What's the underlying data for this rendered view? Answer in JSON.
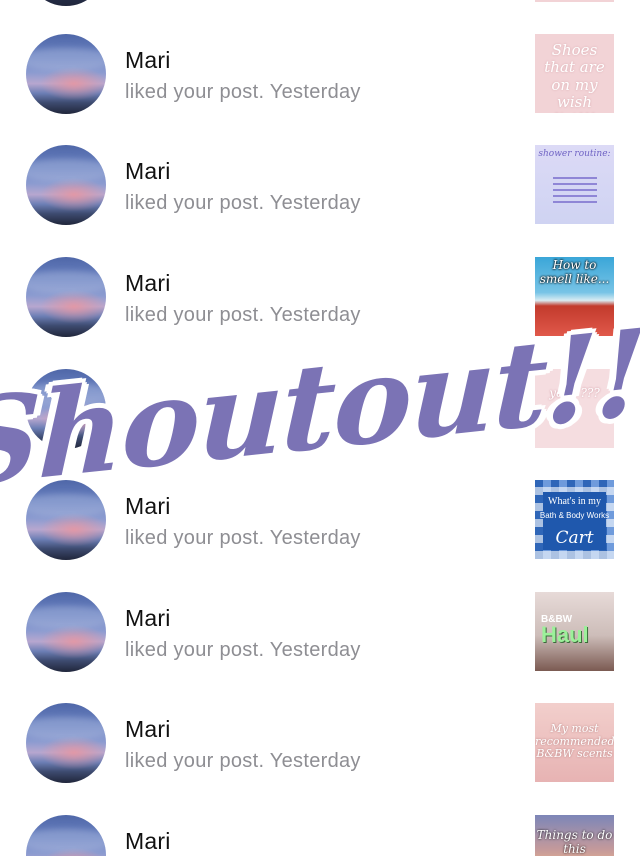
{
  "overlay": {
    "text": "Shoutout!!!",
    "color": "#7b73b5"
  },
  "colors": {
    "name": "#111111",
    "secondary": "#8e8e93",
    "background": "#ffffff"
  },
  "notifications": [
    {
      "name": "Mari",
      "action": "liked your post. Yesterday",
      "thumb_text": "Shoes that are on my wish list!!!"
    },
    {
      "name": "Mari",
      "action": "liked your post. Yesterday",
      "thumb_text": "shower routine:"
    },
    {
      "name": "Mari",
      "action": "liked your post. Yesterday",
      "thumb_text": "How to smell like..."
    },
    {
      "name": "",
      "action": "",
      "thumb_text": "your ???"
    },
    {
      "name": "Mari",
      "action": "liked your post. Yesterday",
      "thumb_text": "What's in my",
      "thumb_sub": "Bath & Body Works",
      "thumb_big": "Cart"
    },
    {
      "name": "Mari",
      "action": "liked your post. Yesterday",
      "thumb_text": "B&BW",
      "thumb_big": "Haul"
    },
    {
      "name": "Mari",
      "action": "liked your post. Yesterday",
      "thumb_text": "My most recommended B&BW scents"
    },
    {
      "name": "Mari",
      "action": "",
      "thumb_text": "Things to do this"
    }
  ]
}
